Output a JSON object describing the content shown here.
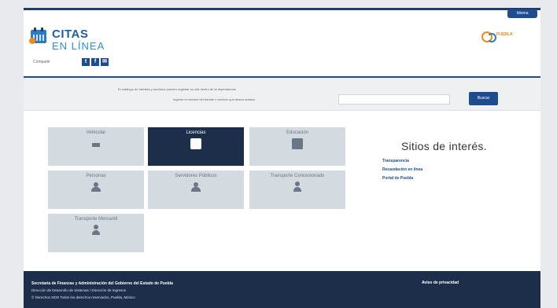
{
  "header": {
    "lang_button": "Idioma",
    "logo_line1": "CITAS",
    "logo_line2": "EN LÍNEA",
    "share_label": "Compartir",
    "social": [
      {
        "icon": "twitter-icon",
        "glyph": "t"
      },
      {
        "icon": "facebook-icon",
        "glyph": "f"
      },
      {
        "icon": "email-icon",
        "glyph": "✉"
      }
    ],
    "brand_text": "PUEBLA"
  },
  "search": {
    "line1": "El catálogo de trámites y servicios pueden registrar su cita dentro de la dependencia",
    "line2": "Ingrese el nombre del trámite o servicio que desea realizar",
    "placeholder": "",
    "button": "Buscar"
  },
  "tiles": [
    {
      "label": "Vehicular",
      "icon": "car-icon",
      "active": false
    },
    {
      "label": "Licencias",
      "icon": "license-card-icon",
      "active": true
    },
    {
      "label": "Educación",
      "icon": "education-icon",
      "active": false
    },
    {
      "label": "Personas",
      "icon": "people-icon",
      "active": false
    },
    {
      "label": "Servidores Públicos",
      "icon": "public-servants-icon",
      "active": false
    },
    {
      "label": "Transporte Concesionado",
      "icon": "transport-icon",
      "active": false
    },
    {
      "label": "Transporte Mercantil",
      "icon": "cargo-transport-icon",
      "active": false
    }
  ],
  "sidebar": {
    "title": "Sitios de interés.",
    "links": [
      "Transparencia",
      "Recaudación en línea",
      "Portal de Puebla"
    ]
  },
  "footer": {
    "line1": "Secretaría de Finanzas y Administración del Gobierno del Estado de Puebla",
    "line2": "Dirección de Desarrollo de Sistemas / Dirección de Ingresos",
    "line3": "© Derechos 2020 Todos los derechos reservados, Puebla, México",
    "privacy": "Aviso de privacidad"
  }
}
